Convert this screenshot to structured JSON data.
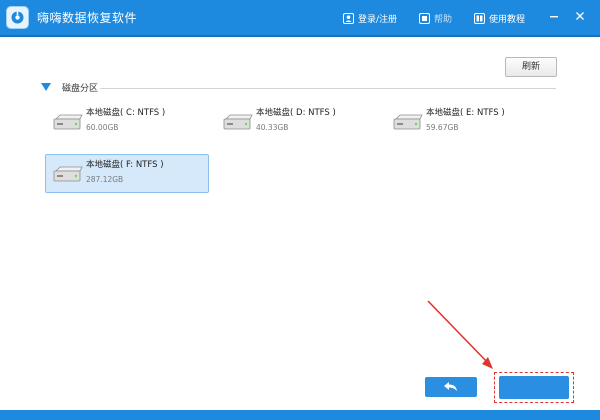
{
  "app": {
    "title": "嗨嗨数据恢复软件"
  },
  "toolbar": {
    "login_label": "登录/注册",
    "item2_label": "帮助",
    "tutorial_label": "使用教程"
  },
  "content": {
    "refresh_label": "刷新",
    "section_title": "磁盘分区",
    "drives": [
      {
        "name": "本地磁盘( C: NTFS )",
        "size": "60.00GB",
        "selected": false
      },
      {
        "name": "本地磁盘( D: NTFS )",
        "size": "40.33GB",
        "selected": false
      },
      {
        "name": "本地磁盘( E: NTFS )",
        "size": "59.67GB",
        "selected": false
      },
      {
        "name": "本地磁盘( F: NTFS )",
        "size": "287.12GB",
        "selected": true
      }
    ]
  },
  "footer": {
    "back_icon": "back-arrow-icon",
    "next_label": ""
  },
  "colors": {
    "accent": "#1d8ae0",
    "selected_bg": "#d5e9fb",
    "annotation_red": "#e0352f"
  }
}
